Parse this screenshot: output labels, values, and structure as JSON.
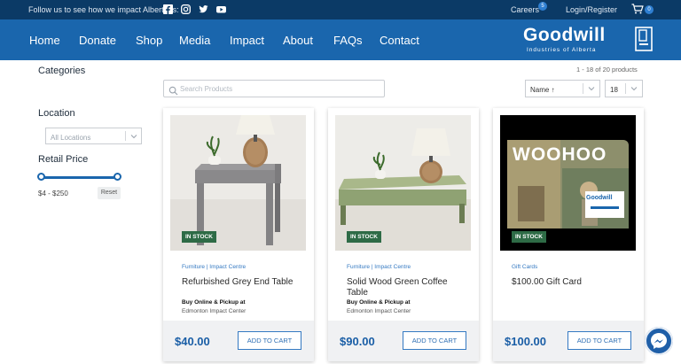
{
  "topbar": {
    "follow_text": "Follow us to see how we impact Albertans:",
    "social": [
      "facebook-icon",
      "instagram-icon",
      "twitter-icon",
      "youtube-icon"
    ],
    "careers": "Careers",
    "careers_badge": "5",
    "login": "Login/Register",
    "cart_count": "0"
  },
  "nav": {
    "items": [
      "Home",
      "Donate",
      "Shop",
      "Media",
      "Impact",
      "About",
      "FAQs",
      "Contact"
    ]
  },
  "logo": {
    "word": "Goodwill",
    "sub": "Industries of Alberta"
  },
  "sidebar": {
    "categories": "Categories",
    "location": "Location",
    "location_value": "All Locations",
    "retail_price": "Retail Price",
    "range": "$4 - $250",
    "range_min_fraction": 0,
    "range_max_fraction": 1,
    "reset": "Reset"
  },
  "toolbar": {
    "count": "1 - 18 of 20 products",
    "search_placeholder": "Search Products",
    "sort_value": "Name ↑",
    "per_page": "18"
  },
  "products": [
    {
      "stock": "IN STOCK",
      "category": "Furniture | Impact Centre",
      "name": "Refurbished Grey End Table",
      "pickup": "Buy Online & Pickup at",
      "location": "Edmonton Impact Center",
      "price": "$40.00",
      "cta": "ADD TO CART"
    },
    {
      "stock": "IN STOCK",
      "category": "Furniture | Impact Centre",
      "name": "Solid Wood Green Coffee Table",
      "pickup": "Buy Online & Pickup at",
      "location": "Edmonton Impact Center",
      "price": "$90.00",
      "cta": "ADD TO CART"
    },
    {
      "stock": "IN STOCK",
      "category": "Gift Cards",
      "name": "$100.00 Gift Card",
      "gift_text": "WOOHOO",
      "gift_brand": "Goodwill",
      "price": "$100.00",
      "cta": "ADD TO CART"
    }
  ],
  "colors": {
    "topbar": "#0b3a66",
    "nav": "#1a66ad",
    "accent": "#3479c2",
    "stock": "#2e6b46"
  }
}
